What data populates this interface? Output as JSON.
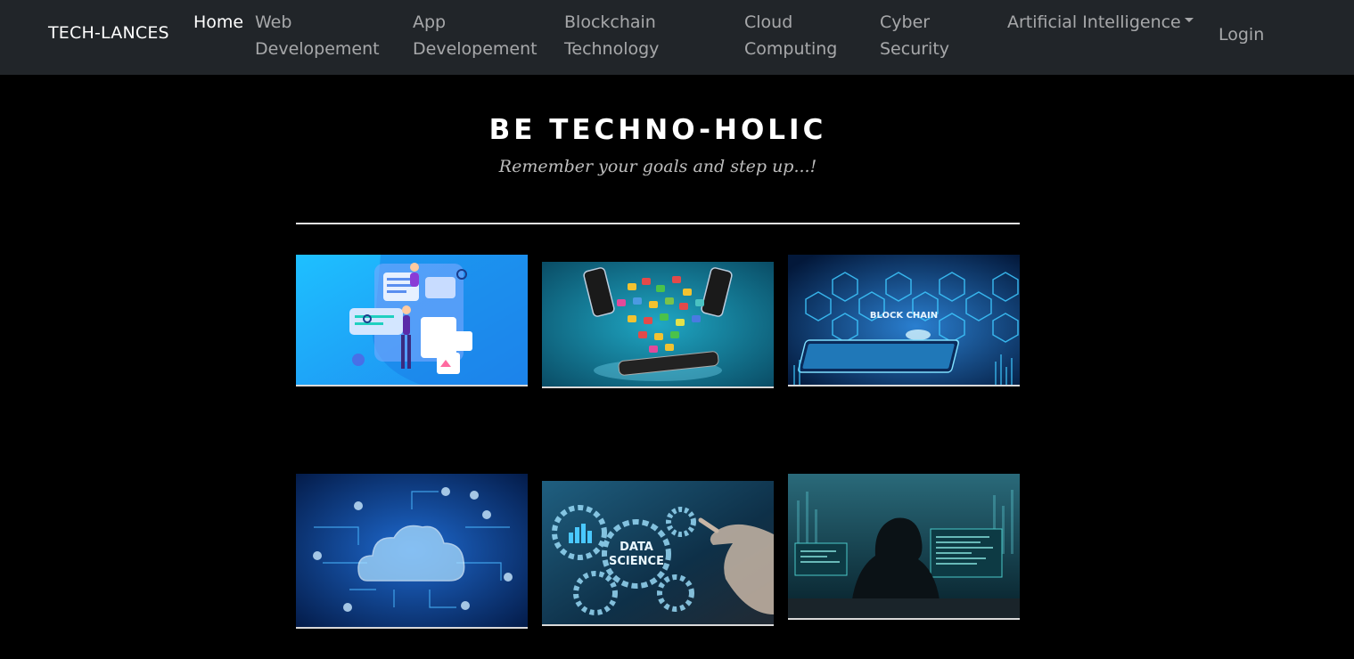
{
  "brand": "TECH-LANCES",
  "nav": {
    "home": "Home",
    "web": [
      "Web",
      "Developement"
    ],
    "app": [
      "App",
      "Developement"
    ],
    "blockchain": [
      "Blockchain",
      "Technology"
    ],
    "cloud": [
      "Cloud",
      "Computing"
    ],
    "cyber": [
      "Cyber",
      "Security"
    ],
    "ai": "Artificial Intelligence",
    "login": "Login"
  },
  "hero": {
    "title": "BE TECHNO-HOLIC",
    "subtitle": "Remember your goals and step up...!"
  },
  "cards": {
    "blockchain_label": "BLOCK CHAIN",
    "datascience_label_1": "DATA",
    "datascience_label_2": "SCIENCE"
  },
  "colors": {
    "navbar_bg": "#212529",
    "page_bg": "#000000"
  }
}
